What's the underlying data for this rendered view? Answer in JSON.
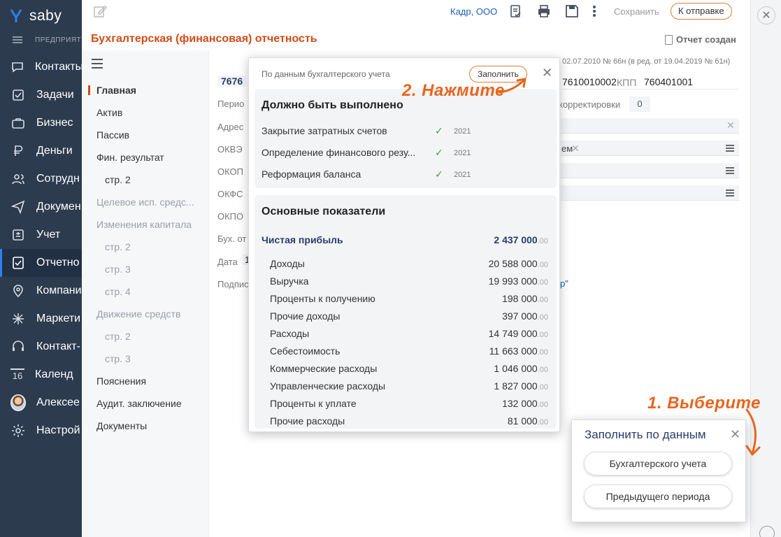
{
  "app": {
    "name": "saby",
    "org_line": "ПРЕДПРИЯТ"
  },
  "nav": {
    "items": [
      {
        "label": "Контакты",
        "icon": "chat-icon"
      },
      {
        "label": "Задачи",
        "icon": "tasks-icon"
      },
      {
        "label": "Бизнес",
        "icon": "briefcase-icon"
      },
      {
        "label": "Деньги",
        "icon": "money-icon"
      },
      {
        "label": "Сотрудн",
        "icon": "people-icon"
      },
      {
        "label": "Докумен",
        "icon": "paper-plane-icon"
      },
      {
        "label": "Учет",
        "icon": "accounting-icon"
      },
      {
        "label": "Отчетно",
        "icon": "report-check-icon"
      },
      {
        "label": "Компани",
        "icon": "location-icon"
      },
      {
        "label": "Маркети",
        "icon": "sparkle-icon"
      },
      {
        "label": "Контакт-",
        "icon": "headset-icon"
      },
      {
        "label": "Календ",
        "icon": "calendar-icon"
      },
      {
        "label": "Алексее",
        "icon": "avatar"
      },
      {
        "label": "Настрой",
        "icon": "gear-icon"
      }
    ],
    "calendar_day": "16"
  },
  "header": {
    "org_name": "Кадр, ООО",
    "save_label": "Сохранить",
    "send_label": "К отправке",
    "doc_title": "Бухгалтерская (финансовая) отчетность",
    "status": "Отчет создан"
  },
  "sections": [
    {
      "label": "Главная",
      "state": "active"
    },
    {
      "label": "Актив",
      "state": "normal"
    },
    {
      "label": "Пассив",
      "state": "normal"
    },
    {
      "label": "Фин. результат",
      "state": "normal"
    },
    {
      "label": "стр. 2",
      "state": "normal"
    },
    {
      "label": "Целевое исп. средс...",
      "state": "muted"
    },
    {
      "label": "Изменения капитала",
      "state": "muted"
    },
    {
      "label": "стр. 2",
      "state": "muted"
    },
    {
      "label": "стр. 3",
      "state": "muted"
    },
    {
      "label": "стр. 4",
      "state": "muted"
    },
    {
      "label": "Движение средств",
      "state": "muted"
    },
    {
      "label": "стр. 2",
      "state": "muted"
    },
    {
      "label": "стр. 3",
      "state": "muted"
    },
    {
      "label": "Пояснения",
      "state": "normal"
    },
    {
      "label": "Аудит. заключение",
      "state": "normal"
    },
    {
      "label": "Документы",
      "state": "normal"
    }
  ],
  "form": {
    "order_ref": "02.07.2010 № 66н (в ред. от 19.04.2019 № 61н)",
    "inn_prefix": "7676",
    "inn_rest": "7610010002",
    "kpp_label": "КПП",
    "kpp_value": "760401001",
    "period_label": "Перио",
    "correction_label": "корректировки",
    "correction_value": "0",
    "address_label": "Адрес",
    "okved_label": "ОКВЭ",
    "okved_value_tail": "ем",
    "okopf_label": "ОКОП",
    "okfs_label": "ОКФС",
    "okpo_label": "ОКПО",
    "buh_label": "Бух. от",
    "date_label": "Дата",
    "date_value": "1",
    "signer_label": "Подпис",
    "signer_tail": "р\""
  },
  "popup": {
    "source_label": "По данным бухгалтерского учета",
    "fill_button": "Заполнить",
    "todo_title": "Должно быть выполнено",
    "todo": [
      {
        "label": "Закрытие затратных счетов",
        "year": "2021"
      },
      {
        "label": "Определение финансового резу...",
        "year": "2021"
      },
      {
        "label": "Реформация баланса",
        "year": "2021"
      }
    ],
    "indicators_title": "Основные показатели",
    "net_profit_label": "Чистая прибыль",
    "net_profit_value": "2 437 000",
    "decimals": ".00",
    "indicators": [
      {
        "label": "Доходы",
        "value": "20 588 000"
      },
      {
        "label": "Выручка",
        "value": "19 993 000"
      },
      {
        "label": "Проценты к получению",
        "value": "198 000"
      },
      {
        "label": "Прочие доходы",
        "value": "397 000"
      },
      {
        "label": "Расходы",
        "value": "14 749 000"
      },
      {
        "label": "Себестоимость",
        "value": "11 663 000"
      },
      {
        "label": "Коммерческие расходы",
        "value": "1 046 000"
      },
      {
        "label": "Управленческие расходы",
        "value": "1 827 000"
      },
      {
        "label": "Проценты к уплате",
        "value": "132 000"
      },
      {
        "label": "Прочие расходы",
        "value": "81 000"
      }
    ]
  },
  "fill_card": {
    "title": "Заполнить по данным",
    "option1": "Бухгалтерского учета",
    "option2": "Предыдущего периода"
  },
  "annotations": {
    "step1": "1. Выберите",
    "step2": "2. Нажмите",
    "color": "#e8651d"
  },
  "colors": {
    "accent": "#cf4d16",
    "nav_bg": "#2d3b4e",
    "link": "#1b5fb5"
  }
}
